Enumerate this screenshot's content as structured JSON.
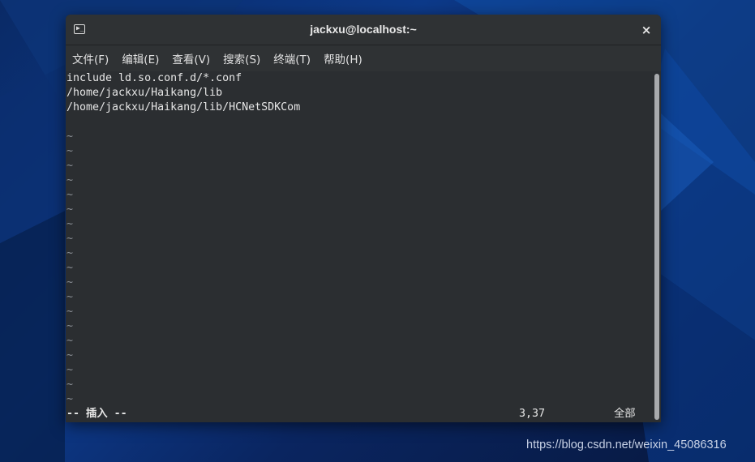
{
  "window": {
    "title": "jackxu@localhost:~",
    "close_label": "×",
    "icon_glyph": "▶_"
  },
  "menu": [
    {
      "label": "文件(F)"
    },
    {
      "label": "编辑(E)"
    },
    {
      "label": "查看(V)"
    },
    {
      "label": "搜索(S)"
    },
    {
      "label": "终端(T)"
    },
    {
      "label": "帮助(H)"
    }
  ],
  "editor": {
    "lines": [
      "include ld.so.conf.d/*.conf",
      "/home/jackxu/Haikang/lib",
      "/home/jackxu/Haikang/lib/HCNetSDKCom",
      ""
    ],
    "tildes": [
      "~",
      "~",
      "~",
      "~",
      "~",
      "~",
      "~",
      "~",
      "~",
      "~",
      "~",
      "~",
      "~",
      "~",
      "~",
      "~",
      "~",
      "~",
      "~"
    ],
    "status": {
      "mode": "-- 插入 --",
      "position": "3,37",
      "scope": "全部"
    }
  },
  "watermark": "https://blog.csdn.net/weixin_45086316",
  "colors": {
    "terminal_bg": "#2b2e31",
    "titlebar_bg": "#2f3234",
    "text": "#e6e6e6",
    "desktop_bg": "#0a2a66"
  }
}
